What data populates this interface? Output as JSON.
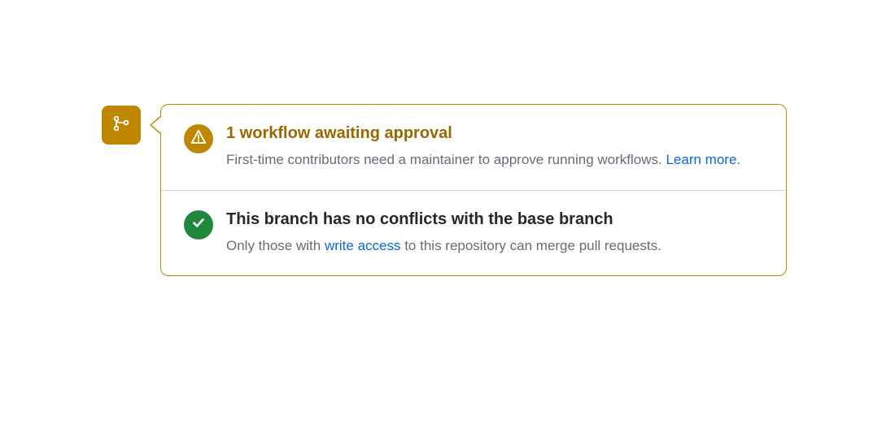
{
  "colors": {
    "warning": "#bf8700",
    "success": "#1f883d",
    "link": "#0969da",
    "text_primary": "#24292f",
    "text_secondary": "#656d76",
    "border": "#d0d7de"
  },
  "timeline_icon": "git-merge-icon",
  "sections": [
    {
      "status": "warning",
      "icon": "alert-icon",
      "title": "1 workflow awaiting approval",
      "desc_prefix": "First-time contributors need a maintainer to approve running workflows. ",
      "link_text": "Learn more.",
      "desc_suffix": ""
    },
    {
      "status": "success",
      "icon": "check-icon",
      "title": "This branch has no conflicts with the base branch",
      "desc_prefix": "Only those with ",
      "link_text": "write access",
      "desc_suffix": " to this repository can merge pull requests."
    }
  ]
}
